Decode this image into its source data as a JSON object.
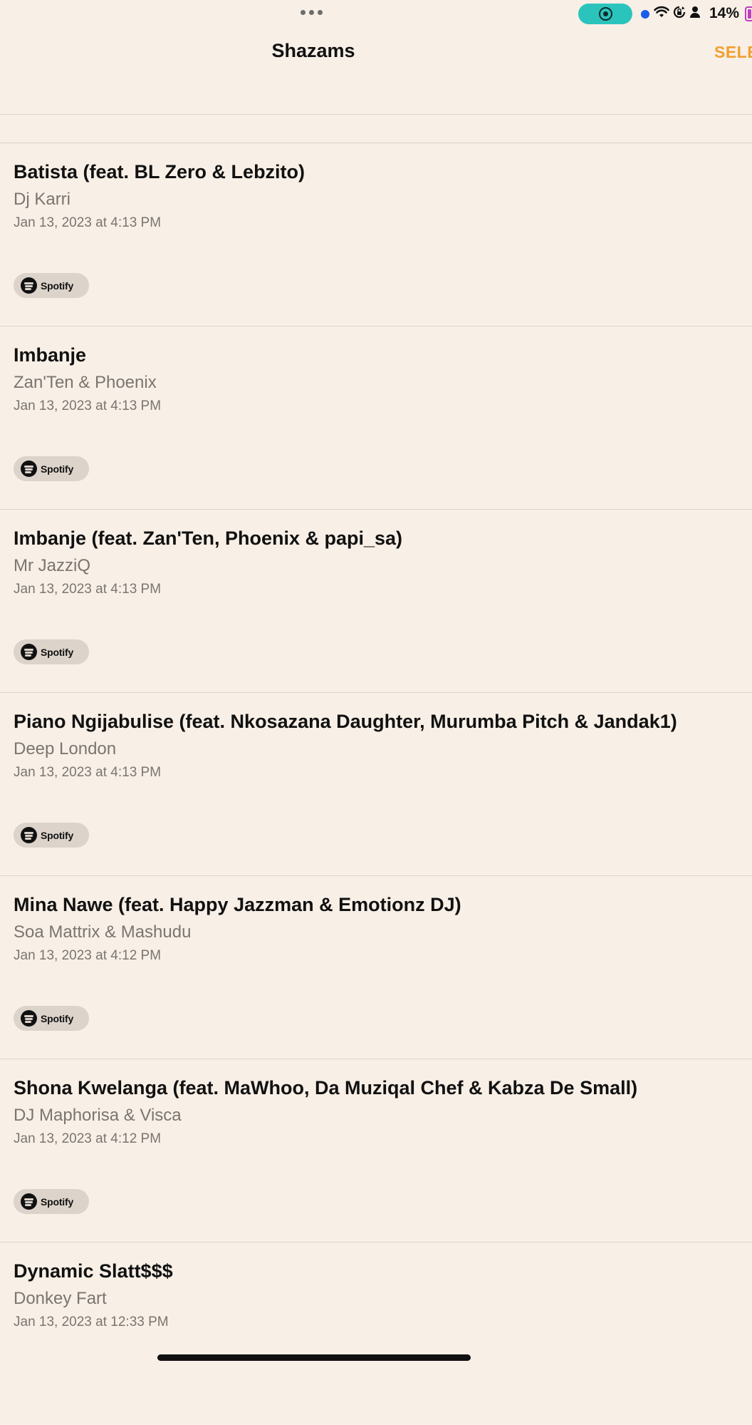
{
  "status_bar": {
    "battery_percent": "14%",
    "icons": [
      "more-dots-icon",
      "screen-record-icon",
      "location-dot-icon",
      "wifi-icon",
      "rotation-lock-icon",
      "person-icon",
      "battery-icon"
    ]
  },
  "nav": {
    "title": "Shazams",
    "select_label": "SELE"
  },
  "colors": {
    "background": "#f8efe6",
    "accent": "#f0a030",
    "record_pill": "#2bc4bd",
    "spotify_button": "#dcd3cb"
  },
  "songs": [
    {
      "title": "Batista (feat. BL Zero & Lebzito)",
      "artist": "Dj Karri",
      "date": "Jan 13, 2023 at 4:13 PM",
      "button": "Spotify"
    },
    {
      "title": "Imbanje",
      "artist": "Zan'Ten & Phoenix",
      "date": "Jan 13, 2023 at 4:13 PM",
      "button": "Spotify"
    },
    {
      "title": "Imbanje (feat. Zan'Ten, Phoenix & papi_sa)",
      "artist": "Mr JazziQ",
      "date": "Jan 13, 2023 at 4:13 PM",
      "button": "Spotify"
    },
    {
      "title": "Piano Ngijabulise (feat. Nkosazana Daughter, Murumba Pitch & Jandak1)",
      "artist": "Deep London",
      "date": "Jan 13, 2023 at 4:13 PM",
      "button": "Spotify"
    },
    {
      "title": "Mina Nawe (feat. Happy Jazzman & Emotionz DJ)",
      "artist": "Soa Mattrix & Mashudu",
      "date": "Jan 13, 2023 at 4:12 PM",
      "button": "Spotify"
    },
    {
      "title": "Shona Kwelanga (feat. MaWhoo, Da Muziqal Chef & Kabza De Small)",
      "artist": "DJ Maphorisa & Visca",
      "date": "Jan 13, 2023 at 4:12 PM",
      "button": "Spotify"
    },
    {
      "title": "Dynamic Slatt$$$",
      "artist": "Donkey Fart",
      "date": "Jan 13, 2023 at 12:33 PM",
      "button": ""
    }
  ]
}
